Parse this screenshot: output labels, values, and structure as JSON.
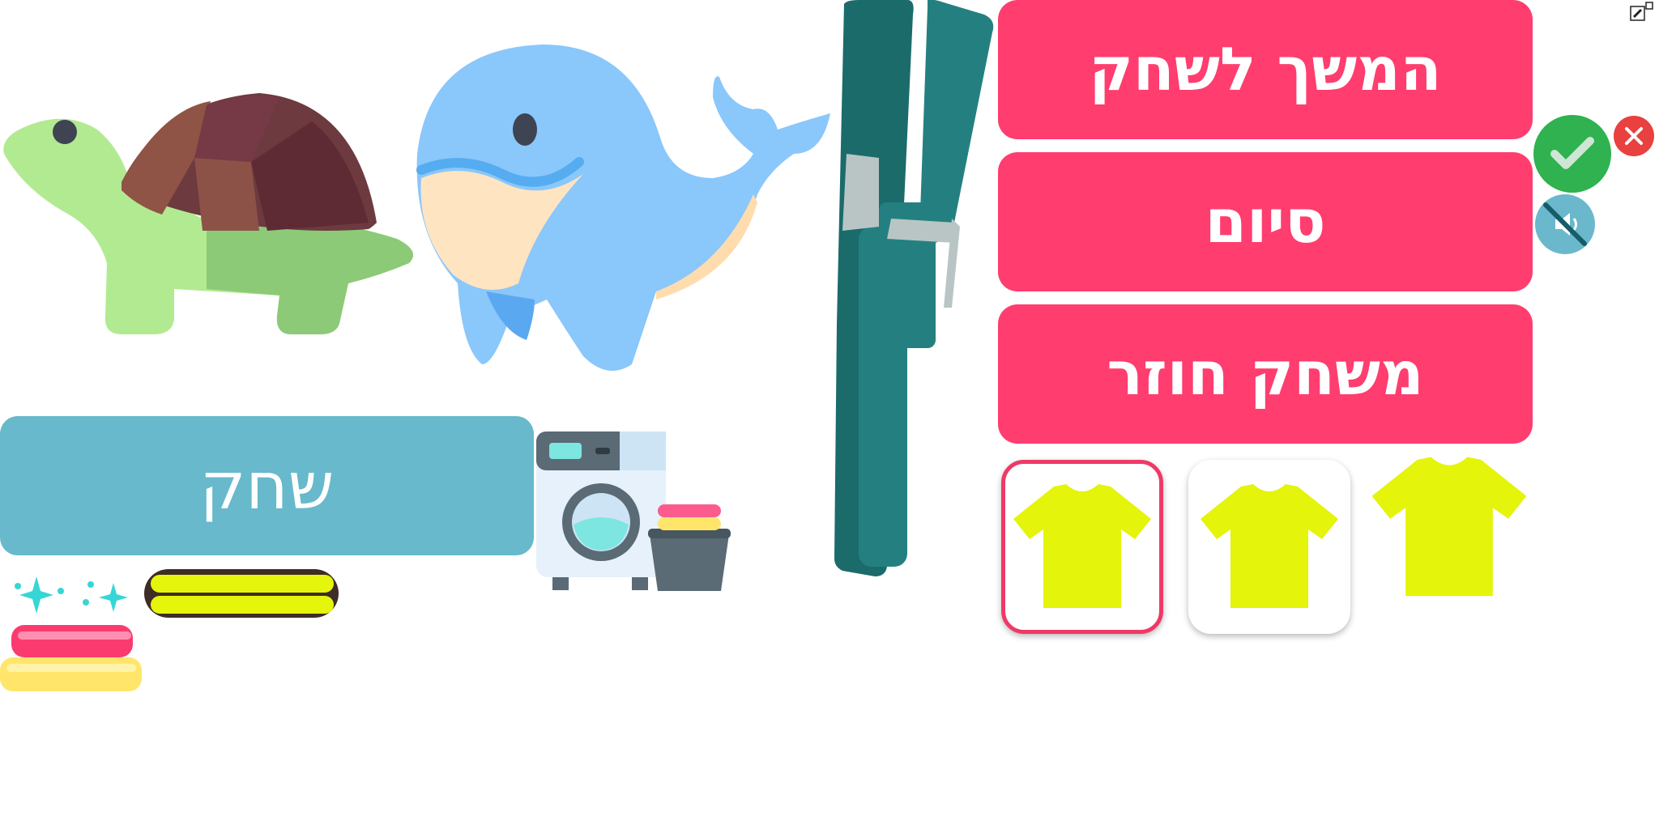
{
  "menu": {
    "continue_label": "המשך לשחק",
    "finish_label": "סיום",
    "replay_label": "משחק חוזר"
  },
  "play_button_label": "שחק",
  "controls": {
    "confirm_icon": "check-icon",
    "close_icon": "close-icon",
    "sound_icon": "mute-icon",
    "corner_icon": "edit-icon"
  },
  "cards": [
    {
      "icon": "tshirt-icon",
      "selected": true
    },
    {
      "icon": "tshirt-icon",
      "selected": false
    },
    {
      "icon": "tshirt-icon",
      "selected": false
    }
  ],
  "colors": {
    "menu_button": "#ff3d6e",
    "play_button": "#67b9cb",
    "tshirt": "#e4f40a",
    "confirm": "#2fb24f",
    "close": "#e94040",
    "sound": "#6bb8cc"
  }
}
